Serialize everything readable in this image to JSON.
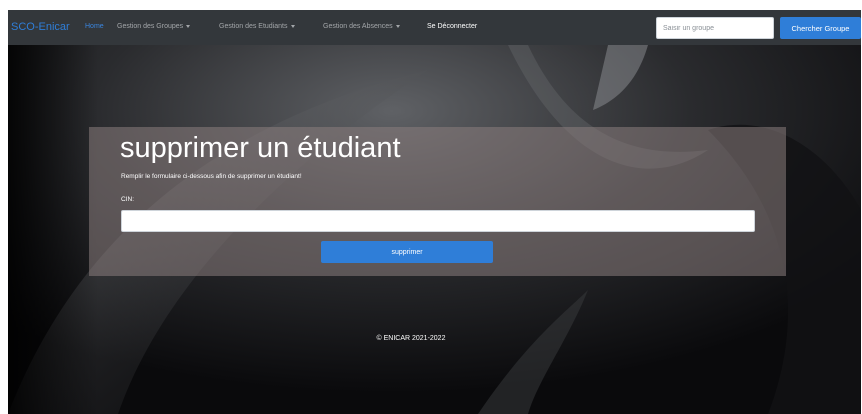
{
  "navbar": {
    "brand": "SCO-Enicar",
    "links": [
      {
        "label": "Home",
        "active": true
      },
      {
        "label": "Gestion des Groupes",
        "dropdown": true
      },
      {
        "label": "Gestion des Etudiants",
        "dropdown": true
      },
      {
        "label": "Gestion des Absences",
        "dropdown": true
      },
      {
        "label": "Se Déconnecter"
      }
    ],
    "search": {
      "placeholder": "Saisir un groupe",
      "value": "",
      "button_label": "Chercher Groupe"
    }
  },
  "form": {
    "title": "supprimer un étudiant",
    "subtitle": "Remplir le formulaire ci-dessous afin de supprimer un étudiant!",
    "cin_label": "CIN:",
    "cin_value": "",
    "submit_label": "supprimer"
  },
  "footer": {
    "text": "© ENICAR 2021-2022"
  },
  "colors": {
    "navbar_bg": "#33373b",
    "brand": "#2f7ed8",
    "primary_button": "#2f7ed8",
    "panel_bg": "#8a7e7e"
  }
}
